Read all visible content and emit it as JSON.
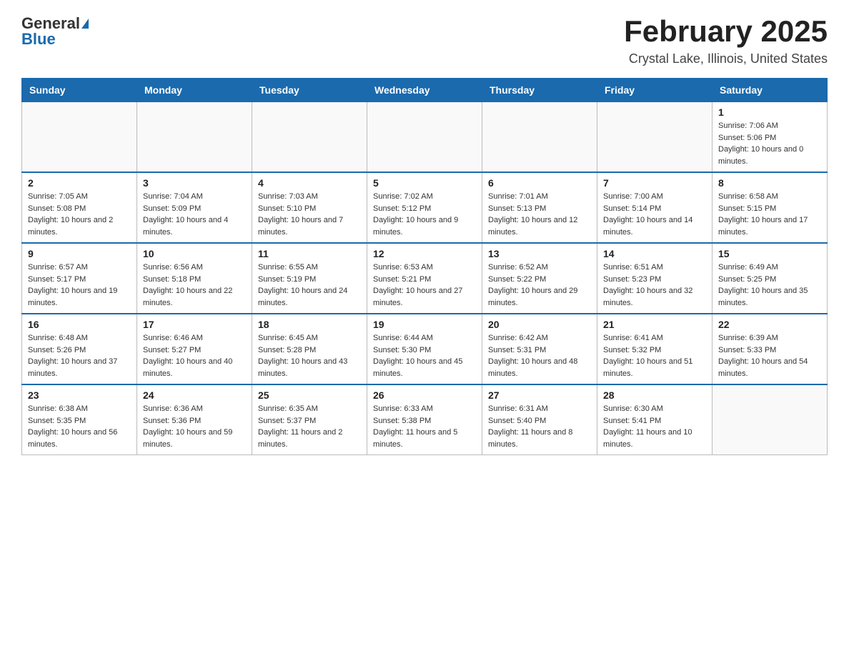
{
  "header": {
    "logo_general": "General",
    "logo_blue": "Blue",
    "title": "February 2025",
    "subtitle": "Crystal Lake, Illinois, United States"
  },
  "weekdays": [
    "Sunday",
    "Monday",
    "Tuesday",
    "Wednesday",
    "Thursday",
    "Friday",
    "Saturday"
  ],
  "weeks": [
    [
      {
        "day": "",
        "info": ""
      },
      {
        "day": "",
        "info": ""
      },
      {
        "day": "",
        "info": ""
      },
      {
        "day": "",
        "info": ""
      },
      {
        "day": "",
        "info": ""
      },
      {
        "day": "",
        "info": ""
      },
      {
        "day": "1",
        "info": "Sunrise: 7:06 AM\nSunset: 5:06 PM\nDaylight: 10 hours and 0 minutes."
      }
    ],
    [
      {
        "day": "2",
        "info": "Sunrise: 7:05 AM\nSunset: 5:08 PM\nDaylight: 10 hours and 2 minutes."
      },
      {
        "day": "3",
        "info": "Sunrise: 7:04 AM\nSunset: 5:09 PM\nDaylight: 10 hours and 4 minutes."
      },
      {
        "day": "4",
        "info": "Sunrise: 7:03 AM\nSunset: 5:10 PM\nDaylight: 10 hours and 7 minutes."
      },
      {
        "day": "5",
        "info": "Sunrise: 7:02 AM\nSunset: 5:12 PM\nDaylight: 10 hours and 9 minutes."
      },
      {
        "day": "6",
        "info": "Sunrise: 7:01 AM\nSunset: 5:13 PM\nDaylight: 10 hours and 12 minutes."
      },
      {
        "day": "7",
        "info": "Sunrise: 7:00 AM\nSunset: 5:14 PM\nDaylight: 10 hours and 14 minutes."
      },
      {
        "day": "8",
        "info": "Sunrise: 6:58 AM\nSunset: 5:15 PM\nDaylight: 10 hours and 17 minutes."
      }
    ],
    [
      {
        "day": "9",
        "info": "Sunrise: 6:57 AM\nSunset: 5:17 PM\nDaylight: 10 hours and 19 minutes."
      },
      {
        "day": "10",
        "info": "Sunrise: 6:56 AM\nSunset: 5:18 PM\nDaylight: 10 hours and 22 minutes."
      },
      {
        "day": "11",
        "info": "Sunrise: 6:55 AM\nSunset: 5:19 PM\nDaylight: 10 hours and 24 minutes."
      },
      {
        "day": "12",
        "info": "Sunrise: 6:53 AM\nSunset: 5:21 PM\nDaylight: 10 hours and 27 minutes."
      },
      {
        "day": "13",
        "info": "Sunrise: 6:52 AM\nSunset: 5:22 PM\nDaylight: 10 hours and 29 minutes."
      },
      {
        "day": "14",
        "info": "Sunrise: 6:51 AM\nSunset: 5:23 PM\nDaylight: 10 hours and 32 minutes."
      },
      {
        "day": "15",
        "info": "Sunrise: 6:49 AM\nSunset: 5:25 PM\nDaylight: 10 hours and 35 minutes."
      }
    ],
    [
      {
        "day": "16",
        "info": "Sunrise: 6:48 AM\nSunset: 5:26 PM\nDaylight: 10 hours and 37 minutes."
      },
      {
        "day": "17",
        "info": "Sunrise: 6:46 AM\nSunset: 5:27 PM\nDaylight: 10 hours and 40 minutes."
      },
      {
        "day": "18",
        "info": "Sunrise: 6:45 AM\nSunset: 5:28 PM\nDaylight: 10 hours and 43 minutes."
      },
      {
        "day": "19",
        "info": "Sunrise: 6:44 AM\nSunset: 5:30 PM\nDaylight: 10 hours and 45 minutes."
      },
      {
        "day": "20",
        "info": "Sunrise: 6:42 AM\nSunset: 5:31 PM\nDaylight: 10 hours and 48 minutes."
      },
      {
        "day": "21",
        "info": "Sunrise: 6:41 AM\nSunset: 5:32 PM\nDaylight: 10 hours and 51 minutes."
      },
      {
        "day": "22",
        "info": "Sunrise: 6:39 AM\nSunset: 5:33 PM\nDaylight: 10 hours and 54 minutes."
      }
    ],
    [
      {
        "day": "23",
        "info": "Sunrise: 6:38 AM\nSunset: 5:35 PM\nDaylight: 10 hours and 56 minutes."
      },
      {
        "day": "24",
        "info": "Sunrise: 6:36 AM\nSunset: 5:36 PM\nDaylight: 10 hours and 59 minutes."
      },
      {
        "day": "25",
        "info": "Sunrise: 6:35 AM\nSunset: 5:37 PM\nDaylight: 11 hours and 2 minutes."
      },
      {
        "day": "26",
        "info": "Sunrise: 6:33 AM\nSunset: 5:38 PM\nDaylight: 11 hours and 5 minutes."
      },
      {
        "day": "27",
        "info": "Sunrise: 6:31 AM\nSunset: 5:40 PM\nDaylight: 11 hours and 8 minutes."
      },
      {
        "day": "28",
        "info": "Sunrise: 6:30 AM\nSunset: 5:41 PM\nDaylight: 11 hours and 10 minutes."
      },
      {
        "day": "",
        "info": ""
      }
    ]
  ]
}
